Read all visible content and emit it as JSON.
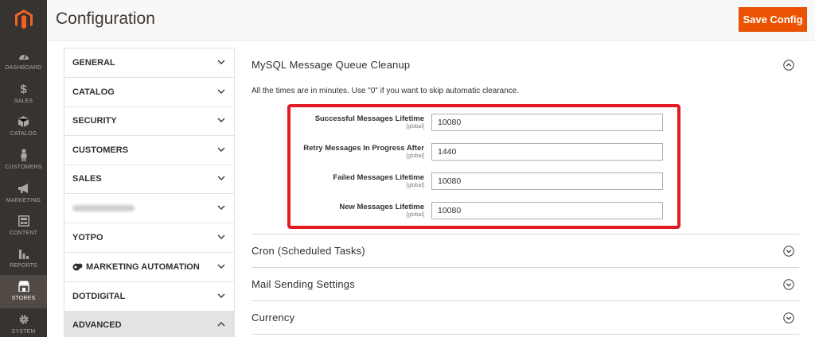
{
  "header": {
    "title": "Configuration",
    "save_label": "Save Config"
  },
  "nav": {
    "items": [
      {
        "label": "DASHBOARD",
        "icon": "dashboard-icon"
      },
      {
        "label": "SALES",
        "icon": "dollar-icon"
      },
      {
        "label": "CATALOG",
        "icon": "cube-icon"
      },
      {
        "label": "CUSTOMERS",
        "icon": "person-icon"
      },
      {
        "label": "MARKETING",
        "icon": "megaphone-icon"
      },
      {
        "label": "CONTENT",
        "icon": "layout-icon"
      },
      {
        "label": "REPORTS",
        "icon": "bar-chart-icon"
      },
      {
        "label": "STORES",
        "icon": "store-icon",
        "active": true
      },
      {
        "label": "SYSTEM",
        "icon": "gear-icon"
      }
    ]
  },
  "config_tabs": [
    {
      "label": "GENERAL"
    },
    {
      "label": "CATALOG"
    },
    {
      "label": "SECURITY"
    },
    {
      "label": "CUSTOMERS"
    },
    {
      "label": "SALES"
    },
    {
      "label": ""
    },
    {
      "label": "YOTPO"
    },
    {
      "label": "MARKETING AUTOMATION"
    },
    {
      "label": "DOTDIGITAL"
    },
    {
      "label": "ADVANCED"
    }
  ],
  "main": {
    "cleanup_section": {
      "title": "MySQL Message Queue Cleanup",
      "note": "All the times are in minutes. Use \"0\" if you want to skip automatic clearance.",
      "fields": [
        {
          "label": "Successful Messages Lifetime",
          "scope": "[global]",
          "value": "10080"
        },
        {
          "label": "Retry Messages In Progress After",
          "scope": "[global]",
          "value": "1440"
        },
        {
          "label": "Failed Messages Lifetime",
          "scope": "[global]",
          "value": "10080"
        },
        {
          "label": "New Messages Lifetime",
          "scope": "[global]",
          "value": "10080"
        }
      ]
    },
    "collapsed_sections": [
      {
        "title": "Cron (Scheduled Tasks)"
      },
      {
        "title": "Mail Sending Settings"
      },
      {
        "title": "Currency"
      }
    ]
  },
  "colors": {
    "accent": "#eb5202",
    "nav_bg": "#373330",
    "highlight_box": "#e11b22"
  }
}
